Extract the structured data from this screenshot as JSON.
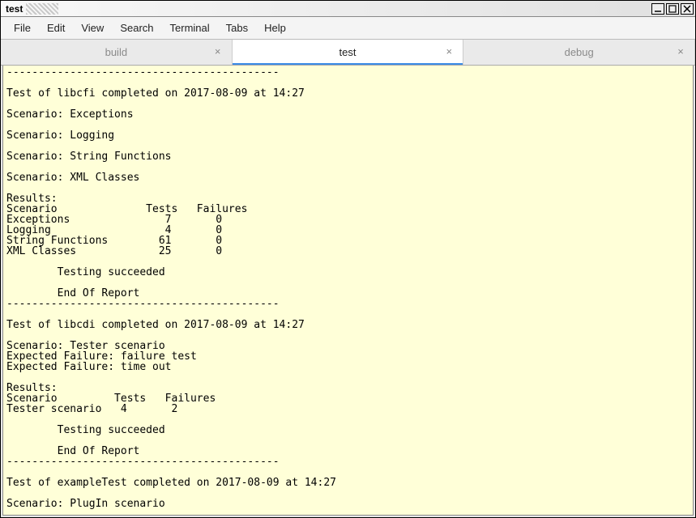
{
  "window": {
    "title": "test"
  },
  "menu": {
    "file": "File",
    "edit": "Edit",
    "view": "View",
    "search": "Search",
    "terminal": "Terminal",
    "tabs": "Tabs",
    "help": "Help"
  },
  "tabs": [
    {
      "label": "build",
      "active": false
    },
    {
      "label": "test",
      "active": true
    },
    {
      "label": "debug",
      "active": false
    }
  ],
  "terminal": {
    "lines": [
      "-------------------------------------------",
      "",
      "Test of libcfi completed on 2017-08-09 at 14:27",
      "",
      "Scenario: Exceptions",
      "",
      "Scenario: Logging",
      "",
      "Scenario: String Functions",
      "",
      "Scenario: XML Classes",
      "",
      "Results:",
      "Scenario              Tests   Failures",
      "Exceptions               7       0",
      "Logging                  4       0",
      "String Functions        61       0",
      "XML Classes             25       0",
      "",
      "        Testing succeeded",
      "",
      "        End Of Report",
      "-------------------------------------------",
      "",
      "Test of libcdi completed on 2017-08-09 at 14:27",
      "",
      "Scenario: Tester scenario",
      "Expected Failure: failure test",
      "Expected Failure: time out",
      "",
      "Results:",
      "Scenario         Tests   Failures",
      "Tester scenario   4       2",
      "",
      "        Testing succeeded",
      "",
      "        End Of Report",
      "-------------------------------------------",
      "",
      "Test of exampleTest completed on 2017-08-09 at 14:27",
      "",
      "Scenario: PlugIn scenario"
    ]
  }
}
